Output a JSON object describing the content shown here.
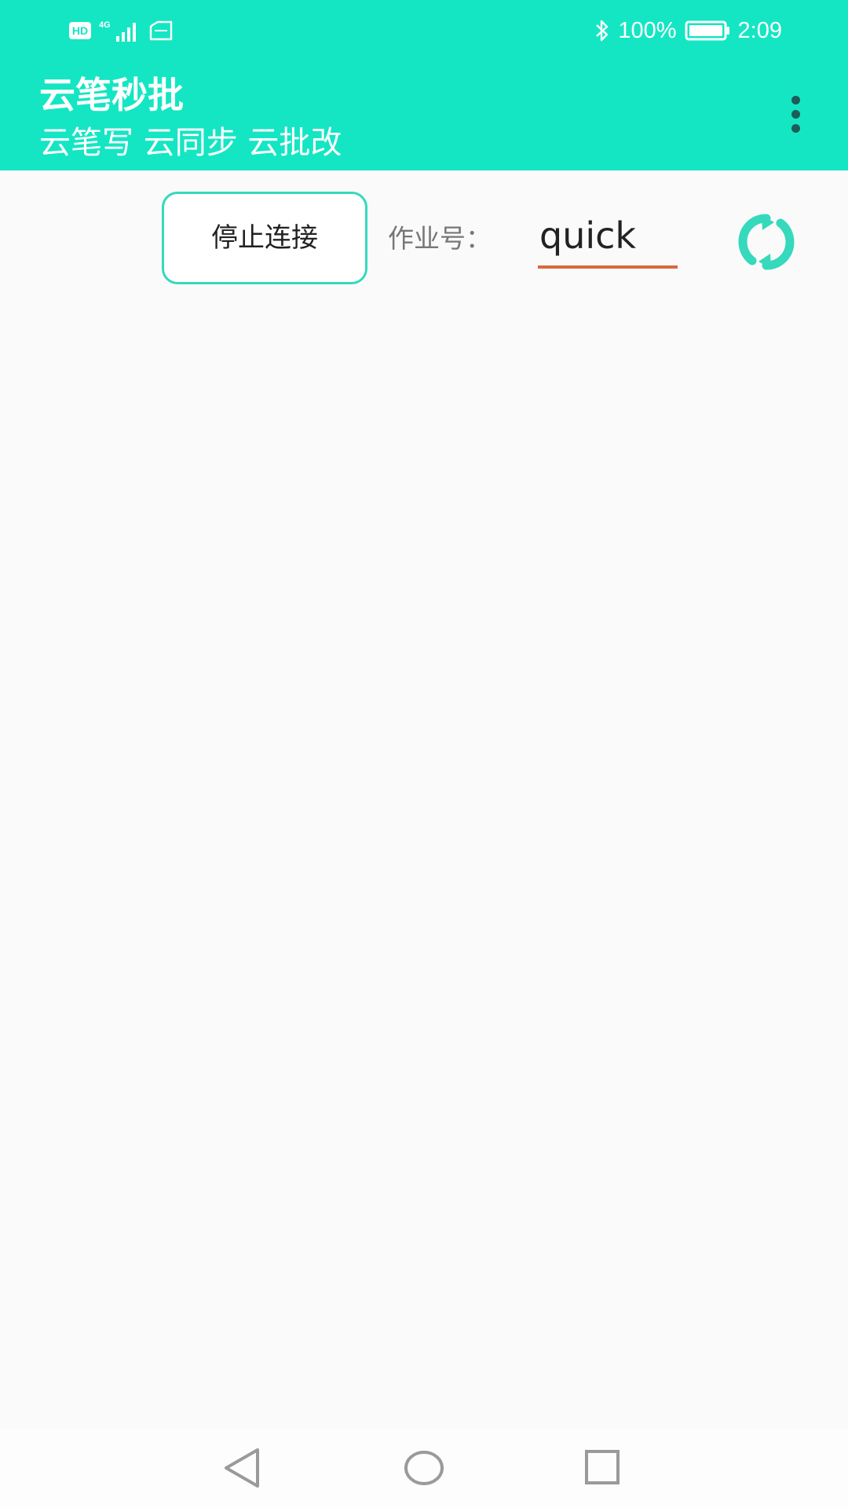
{
  "status_bar": {
    "hd": "HD",
    "network": "4G",
    "battery": "100%",
    "time": "2:09",
    "icons": [
      "sim-card-icon",
      "signal-icon",
      "bluetooth-icon",
      "battery-icon"
    ]
  },
  "header": {
    "title": "云笔秒批",
    "subtitle": "云笔写 云同步 云批改",
    "menu_icon": "overflow-menu-icon",
    "background_color": "#14e6c3"
  },
  "controls": {
    "stop_button_label": "停止连接",
    "homework_label": "作业号：",
    "homework_value": "quick",
    "refresh_icon": "refresh-icon",
    "accent_color": "#35d9bc",
    "input_underline_color": "#d8693c"
  },
  "navigation": {
    "back_icon": "back-icon",
    "home_icon": "home-icon",
    "recents_icon": "recents-icon"
  }
}
